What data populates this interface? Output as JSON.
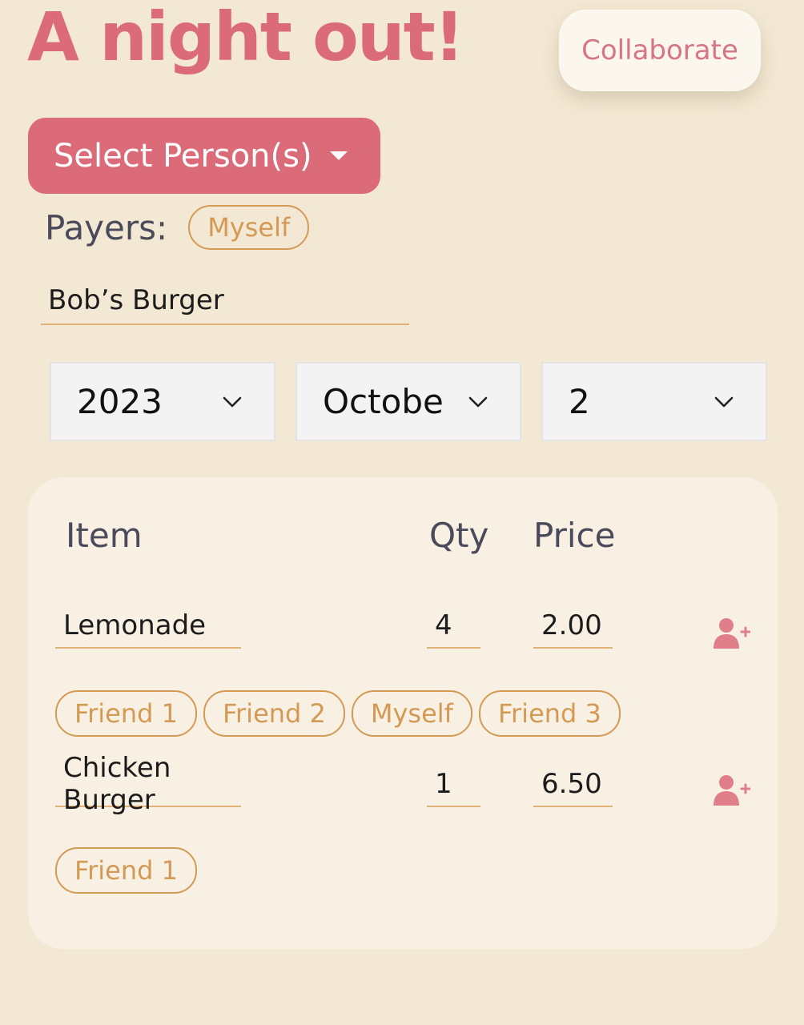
{
  "header": {
    "title": "A night out!",
    "collaborate_label": "Collaborate"
  },
  "select_person": {
    "label": "Select Person(s)"
  },
  "payers": {
    "label": "Payers:",
    "chips": [
      "Myself"
    ]
  },
  "place": {
    "value": "Bob’s Burger"
  },
  "date": {
    "year": "2023",
    "month": "October",
    "day": "2"
  },
  "table": {
    "headers": {
      "item": "Item",
      "qty": "Qty",
      "price": "Price"
    },
    "rows": [
      {
        "item": "Lemonade",
        "qty": "4",
        "price": "2.00",
        "people": [
          "Friend 1",
          "Friend 2",
          "Myself",
          "Friend 3"
        ]
      },
      {
        "item": "Chicken Burger",
        "qty": "1",
        "price": "6.50",
        "people": [
          "Friend 1"
        ]
      }
    ]
  },
  "icons": {
    "add_person": "add-person-icon",
    "dropdown_caret": "caret-down-icon",
    "dropdown_chevron": "chevron-down-icon"
  },
  "colors": {
    "accent": "#dc6b79",
    "background": "#f3e8d3",
    "card": "#f7f0e3",
    "chip": "#d49a55",
    "underline": "#e1b277"
  }
}
